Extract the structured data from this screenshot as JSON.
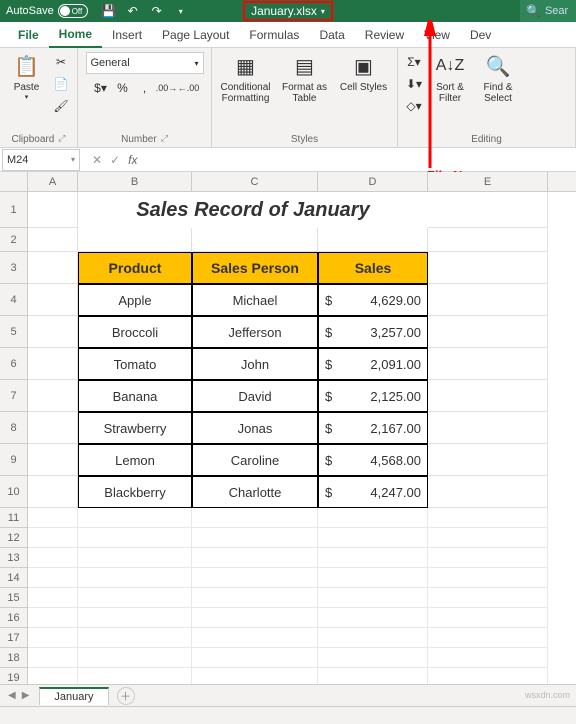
{
  "titlebar": {
    "autosave": "AutoSave",
    "autosave_state": "Off",
    "filename": "January.xlsx",
    "search_placeholder": "Sear"
  },
  "tabs": {
    "file": "File",
    "home": "Home",
    "insert": "Insert",
    "pagelayout": "Page Layout",
    "formulas": "Formulas",
    "data": "Data",
    "review": "Review",
    "view": "View",
    "dev": "Dev"
  },
  "ribbon": {
    "clipboard": {
      "paste": "Paste",
      "label": "Clipboard"
    },
    "number": {
      "format": "General",
      "label": "Number"
    },
    "styles": {
      "cond": "Conditional Formatting",
      "table": "Format as Table",
      "cell": "Cell Styles",
      "label": "Styles"
    },
    "editing": {
      "sort": "Sort & Filter",
      "find": "Find & Select",
      "label": "Editing"
    }
  },
  "namebox": "M24",
  "annotation": "File Name",
  "title": "Sales Record of January",
  "headers": {
    "product": "Product",
    "person": "Sales Person",
    "sales": "Sales"
  },
  "chart_data": {
    "type": "table",
    "columns": [
      "Product",
      "Sales Person",
      "Sales"
    ],
    "rows": [
      {
        "product": "Apple",
        "person": "Michael",
        "sales": "4,629.00"
      },
      {
        "product": "Broccoli",
        "person": "Jefferson",
        "sales": "3,257.00"
      },
      {
        "product": "Tomato",
        "person": "John",
        "sales": "2,091.00"
      },
      {
        "product": "Banana",
        "person": "David",
        "sales": "2,125.00"
      },
      {
        "product": "Strawberry",
        "person": "Jonas",
        "sales": "2,167.00"
      },
      {
        "product": "Lemon",
        "person": "Caroline",
        "sales": "4,568.00"
      },
      {
        "product": "Blackberry",
        "person": "Charlotte",
        "sales": "4,247.00"
      }
    ]
  },
  "currency": "$",
  "sheet": {
    "name": "January"
  },
  "watermark": "wsxdn.com"
}
